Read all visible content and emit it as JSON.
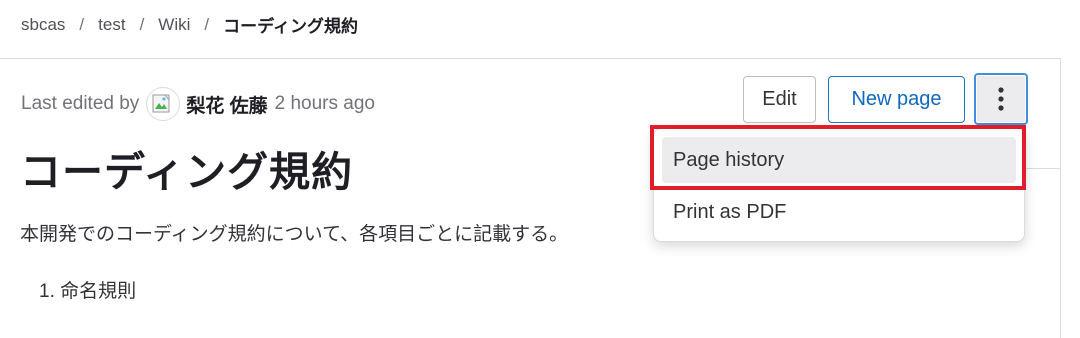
{
  "breadcrumb": {
    "items": [
      "sbcas",
      "test",
      "Wiki"
    ],
    "current": "コーディング規約",
    "separator": "/"
  },
  "meta": {
    "last_edited_label": "Last edited by",
    "author": "梨花 佐藤",
    "time_ago": "2 hours ago"
  },
  "toolbar": {
    "edit_label": "Edit",
    "new_page_label": "New page",
    "more_icon": "kebab-vertical-icon"
  },
  "dropdown": {
    "items": [
      "Page history",
      "Print as PDF"
    ]
  },
  "content": {
    "title": "コーディング規約",
    "intro": "本開発でのコーディング規約について、各項目ごとに記載する。",
    "list_item_1": "1. 命名規則"
  },
  "colors": {
    "accent_blue": "#1068bf",
    "focus_ring": "#428fdc",
    "highlight_red": "#e01e2b"
  }
}
